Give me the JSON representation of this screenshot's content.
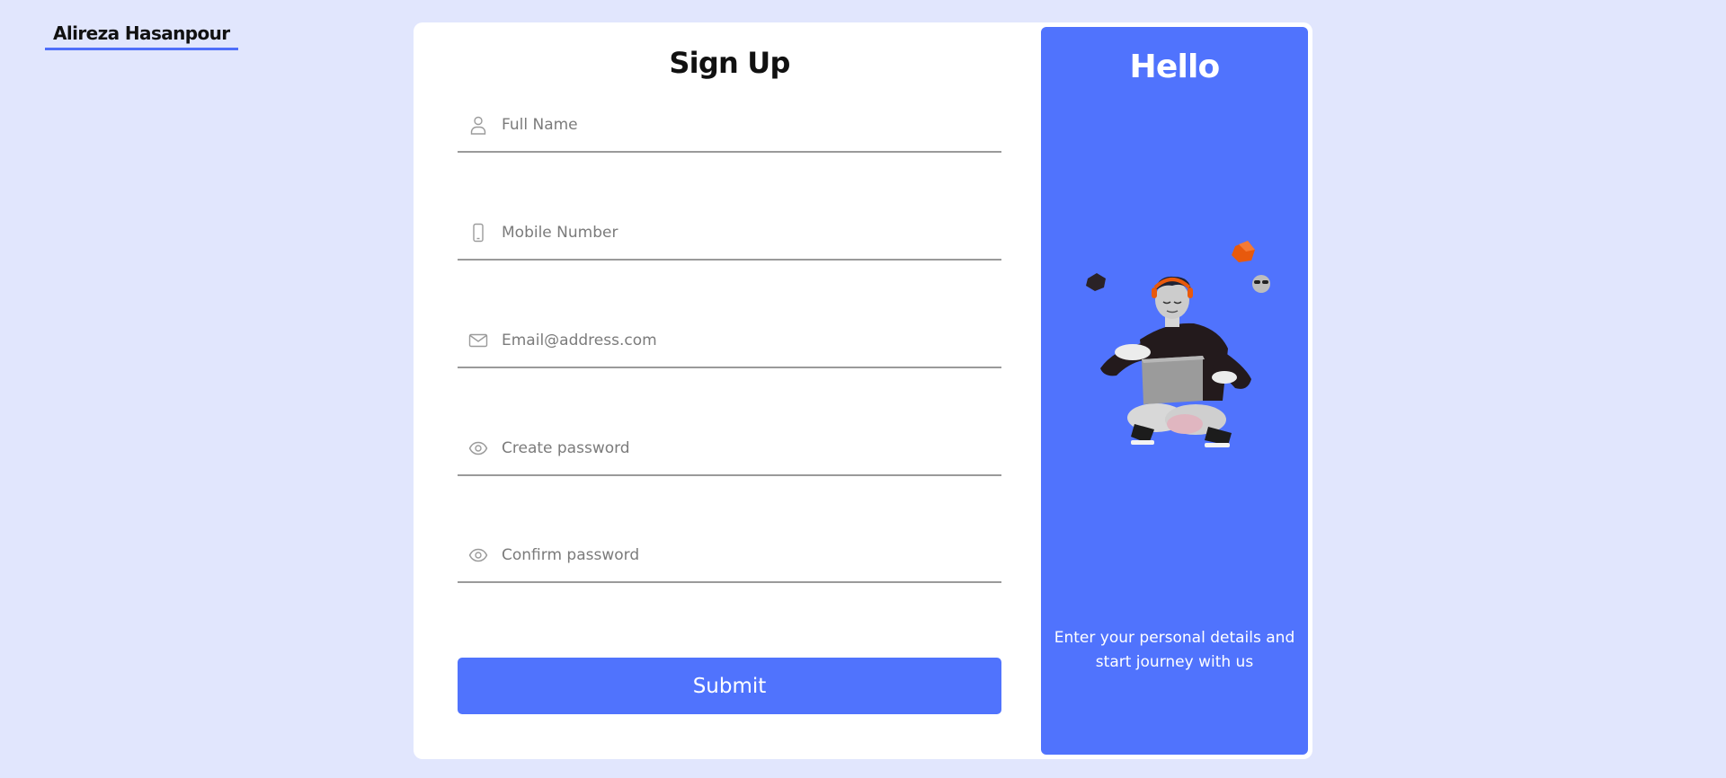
{
  "brand": {
    "name": "Alireza Hasanpour"
  },
  "form": {
    "title": "Sign Up",
    "fields": [
      {
        "placeholder": "Full Name",
        "value": "",
        "icon": "user-icon"
      },
      {
        "placeholder": "Mobile Number",
        "value": "",
        "icon": "mobile-phone-icon"
      },
      {
        "placeholder": "Email@address.com",
        "value": "",
        "icon": "envelope-icon"
      },
      {
        "placeholder": "Create password",
        "value": "",
        "icon": "eye-icon"
      },
      {
        "placeholder": "Confirm password",
        "value": "",
        "icon": "eye-icon"
      }
    ],
    "submit_label": "Submit"
  },
  "panel": {
    "title": "Hello",
    "tagline": "Enter your personal details and start journey with us",
    "illustration": "person-with-laptop-illustration"
  },
  "colors": {
    "page_background": "#e1e6fd",
    "accent": "#5073fd",
    "card_background": "#ffffff",
    "field_underline": "#9a9a9a"
  }
}
